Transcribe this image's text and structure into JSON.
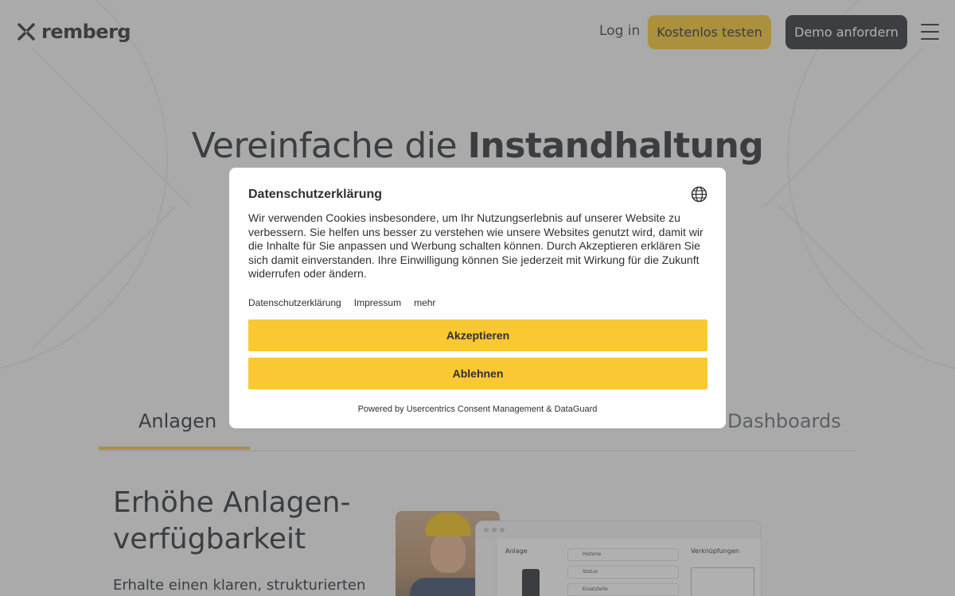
{
  "header": {
    "logo_text": "remberg",
    "login_label": "Log in",
    "trial_label": "Kostenlos testen",
    "demo_label": "Demo anfordern",
    "menu_icon": "hamburger-menu-icon"
  },
  "hero": {
    "title_light": "Vereinfache die ",
    "title_bold": "Instandhaltung"
  },
  "tabs": [
    {
      "label": "Anlagen",
      "active": true
    },
    {
      "label": "Dashboards",
      "active": false
    }
  ],
  "section": {
    "title": "Erhöhe Anlagen-verfügbarkeit",
    "text": "Erhalte einen klaren, strukturierten"
  },
  "app_preview": {
    "panel_title": "Anlage",
    "rows": [
      "Historie",
      "Status",
      "Ersatzteile"
    ],
    "side_title": "Verknüpfungen"
  },
  "consent": {
    "title": "Datenschutzerklärung",
    "body": "Wir verwenden Cookies insbesondere, um Ihr Nutzungserlebnis auf unserer Website zu verbessern. Sie helfen uns besser zu verstehen wie unsere Websites genutzt wird, damit wir die Inhalte für Sie anpassen und Werbung schalten können. Durch Akzeptieren erklären Sie sich damit einverstanden. Ihre Einwilligung können Sie jederzeit mit Wirkung für die Zukunft widerrufen oder ändern.",
    "links": [
      "Datenschutzerklärung",
      "Impressum",
      "mehr"
    ],
    "accept_label": "Akzeptieren",
    "decline_label": "Ablehnen",
    "powered_by": "Powered by Usercentrics Consent Management & DataGuard",
    "language_icon": "globe-icon",
    "accent_color": "#f9c832"
  },
  "colors": {
    "brand_yellow": "#f6c52e",
    "dark": "#2e3136"
  }
}
